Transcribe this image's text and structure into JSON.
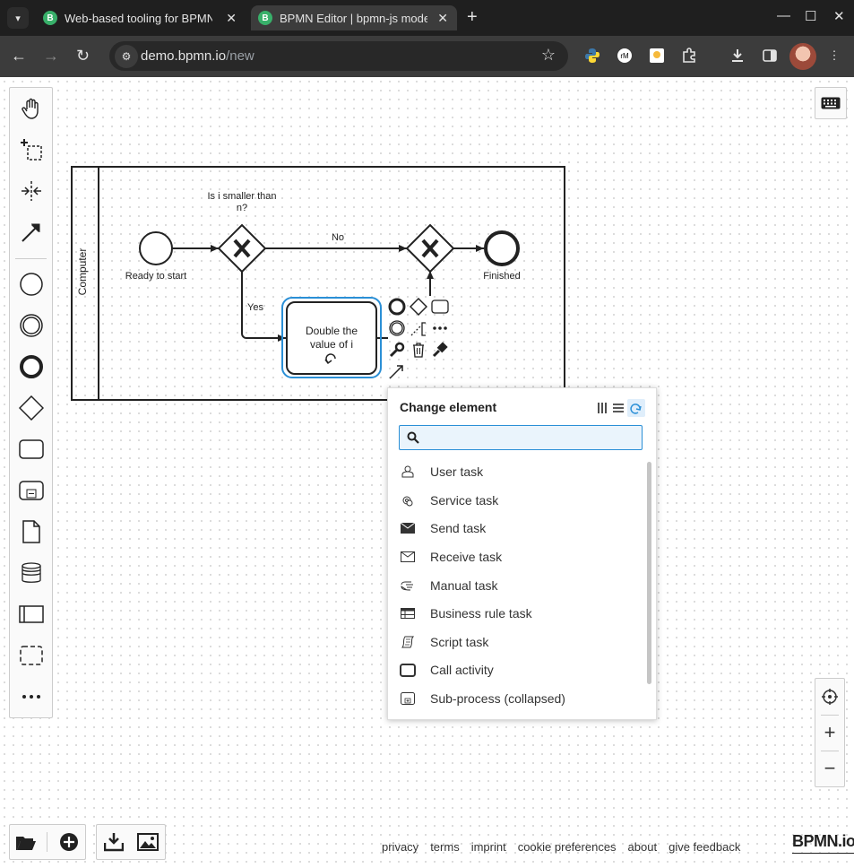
{
  "browser": {
    "tabs": [
      {
        "title": "Web-based tooling for BPMN"
      },
      {
        "title": "BPMN Editor | bpmn-js mode"
      }
    ],
    "url_host": "demo.bpmn.io",
    "url_path": "/new"
  },
  "diagram": {
    "pool_label": "Computer",
    "start_label": "Ready to start",
    "gateway_label": "Is i smaller than n?",
    "flow_no": "No",
    "flow_yes": "Yes",
    "task_label": "Double the value of i",
    "end_label": "Finished",
    "colors": {
      "selection": "#2a8fd6",
      "stroke": "#222222"
    }
  },
  "popup": {
    "title": "Change element",
    "search_placeholder": "",
    "entries": [
      {
        "label": "User task",
        "icon": "user-task-icon"
      },
      {
        "label": "Service task",
        "icon": "service-task-icon"
      },
      {
        "label": "Send task",
        "icon": "send-task-icon"
      },
      {
        "label": "Receive task",
        "icon": "receive-task-icon"
      },
      {
        "label": "Manual task",
        "icon": "manual-task-icon"
      },
      {
        "label": "Business rule task",
        "icon": "business-rule-task-icon"
      },
      {
        "label": "Script task",
        "icon": "script-task-icon"
      },
      {
        "label": "Call activity",
        "icon": "call-activity-icon"
      },
      {
        "label": "Sub-process (collapsed)",
        "icon": "subprocess-collapsed-icon"
      }
    ]
  },
  "footer": {
    "links": [
      "privacy",
      "terms",
      "imprint",
      "cookie preferences",
      "about",
      "give feedback"
    ],
    "logo": "BPMN.io"
  }
}
